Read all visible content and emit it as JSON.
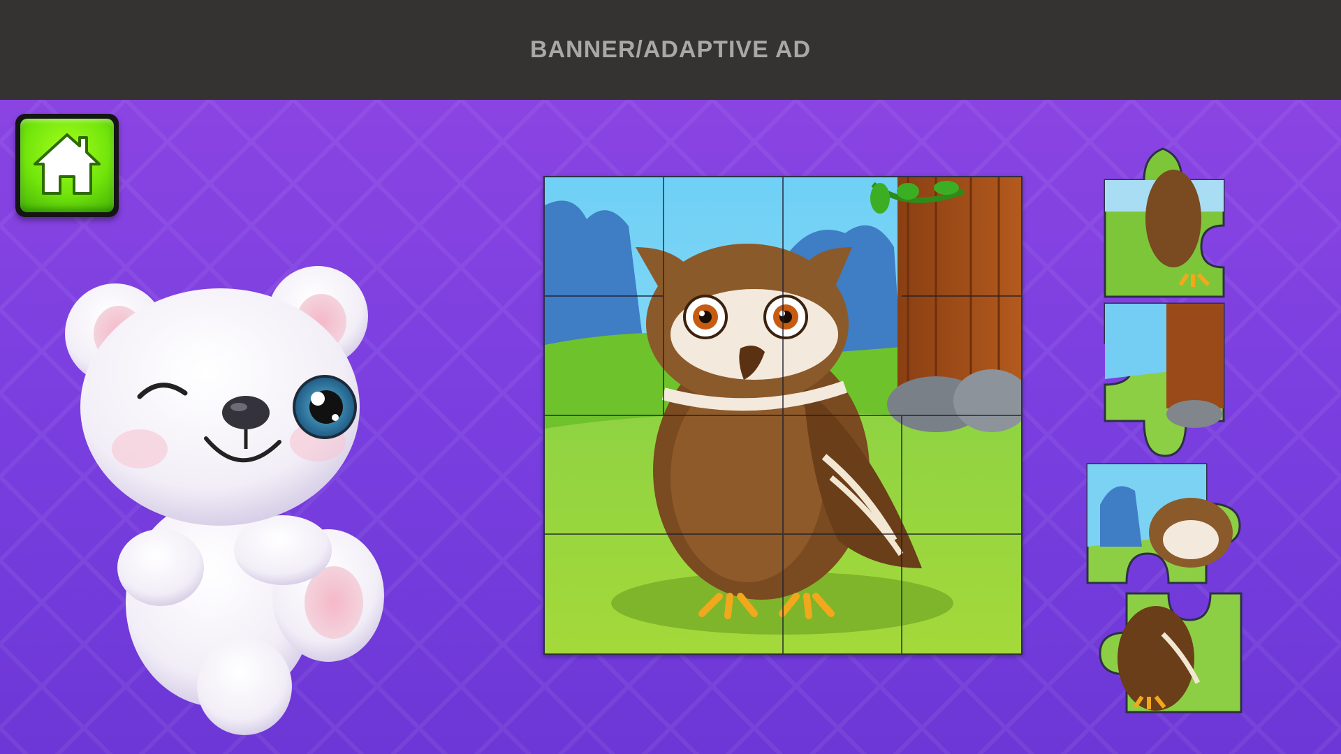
{
  "ad_banner": {
    "text": "BANNER/ADAPTIVE AD"
  },
  "home_button": {
    "icon": "home-icon"
  },
  "board": {
    "rows": 4,
    "cols": 4
  },
  "tray": {
    "piece_count": 4
  },
  "colors": {
    "ad_background": "#353232",
    "game_background": "#7b3fe0",
    "home_button_green": "#72e50b"
  }
}
